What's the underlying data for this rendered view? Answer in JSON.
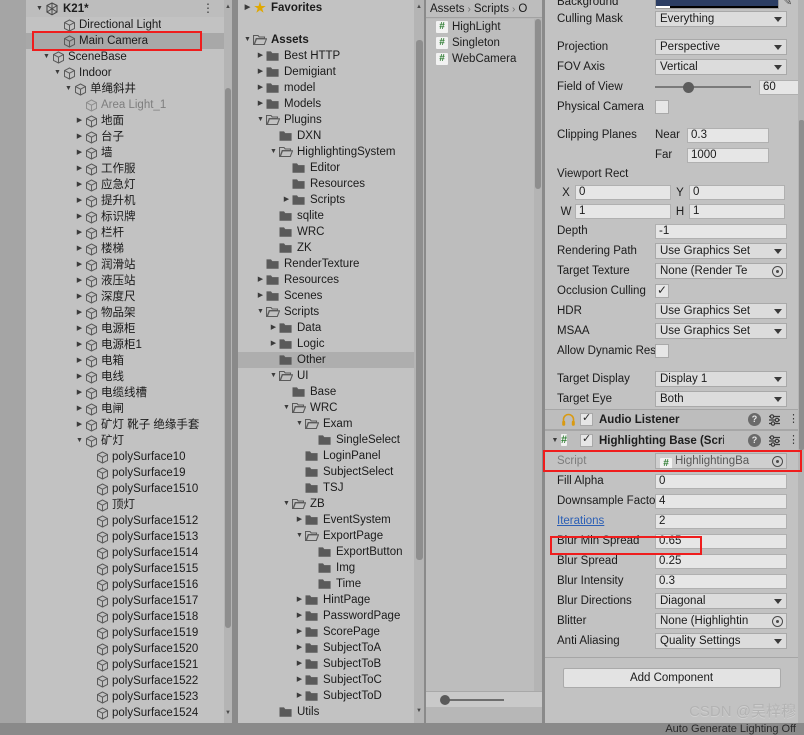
{
  "hierarchy": {
    "scene": {
      "name": "K21*",
      "kebab": "⋮"
    },
    "items": [
      {
        "label": "Directional Light",
        "depth": 2,
        "tri": "none"
      },
      {
        "label": "Main Camera",
        "depth": 2,
        "tri": "none",
        "selected": true
      },
      {
        "label": "SceneBase",
        "depth": 1,
        "tri": "down"
      },
      {
        "label": "Indoor",
        "depth": 2,
        "tri": "down"
      },
      {
        "label": "单绳斜井",
        "depth": 3,
        "tri": "down"
      },
      {
        "label": "Area Light_1",
        "depth": 4,
        "tri": "none",
        "dim": true
      },
      {
        "label": "地面",
        "depth": 4,
        "tri": "right"
      },
      {
        "label": "台子",
        "depth": 4,
        "tri": "right"
      },
      {
        "label": "墙",
        "depth": 4,
        "tri": "right"
      },
      {
        "label": "工作服",
        "depth": 4,
        "tri": "right"
      },
      {
        "label": "应急灯",
        "depth": 4,
        "tri": "right"
      },
      {
        "label": "提升机",
        "depth": 4,
        "tri": "right"
      },
      {
        "label": "标识牌",
        "depth": 4,
        "tri": "right"
      },
      {
        "label": "栏杆",
        "depth": 4,
        "tri": "right"
      },
      {
        "label": "楼梯",
        "depth": 4,
        "tri": "right"
      },
      {
        "label": "润滑站",
        "depth": 4,
        "tri": "right"
      },
      {
        "label": "液压站",
        "depth": 4,
        "tri": "right"
      },
      {
        "label": "深度尺",
        "depth": 4,
        "tri": "right"
      },
      {
        "label": "物品架",
        "depth": 4,
        "tri": "right"
      },
      {
        "label": "电源柜",
        "depth": 4,
        "tri": "right"
      },
      {
        "label": "电源柜1",
        "depth": 4,
        "tri": "right"
      },
      {
        "label": "电箱",
        "depth": 4,
        "tri": "right"
      },
      {
        "label": "电线",
        "depth": 4,
        "tri": "right"
      },
      {
        "label": "电缆线槽",
        "depth": 4,
        "tri": "right"
      },
      {
        "label": "电闸",
        "depth": 4,
        "tri": "right"
      },
      {
        "label": "矿灯 靴子 绝缘手套",
        "depth": 4,
        "tri": "right"
      },
      {
        "label": "矿灯",
        "depth": 4,
        "tri": "down"
      },
      {
        "label": "polySurface10",
        "depth": 5,
        "tri": "none"
      },
      {
        "label": "polySurface19",
        "depth": 5,
        "tri": "none"
      },
      {
        "label": "polySurface1510",
        "depth": 5,
        "tri": "none"
      },
      {
        "label": "顶灯",
        "depth": 5,
        "tri": "none"
      },
      {
        "label": "polySurface1512",
        "depth": 5,
        "tri": "none"
      },
      {
        "label": "polySurface1513",
        "depth": 5,
        "tri": "none"
      },
      {
        "label": "polySurface1514",
        "depth": 5,
        "tri": "none"
      },
      {
        "label": "polySurface1515",
        "depth": 5,
        "tri": "none"
      },
      {
        "label": "polySurface1516",
        "depth": 5,
        "tri": "none"
      },
      {
        "label": "polySurface1517",
        "depth": 5,
        "tri": "none"
      },
      {
        "label": "polySurface1518",
        "depth": 5,
        "tri": "none"
      },
      {
        "label": "polySurface1519",
        "depth": 5,
        "tri": "none"
      },
      {
        "label": "polySurface1520",
        "depth": 5,
        "tri": "none"
      },
      {
        "label": "polySurface1521",
        "depth": 5,
        "tri": "none"
      },
      {
        "label": "polySurface1522",
        "depth": 5,
        "tri": "none"
      },
      {
        "label": "polySurface1523",
        "depth": 5,
        "tri": "none"
      },
      {
        "label": "polySurface1524",
        "depth": 5,
        "tri": "none"
      }
    ]
  },
  "project": {
    "items": [
      {
        "label": "Favorites",
        "depth": 0,
        "tri": "right",
        "icon": "star",
        "bold": true
      },
      {
        "label": "",
        "depth": 0,
        "tri": "none",
        "icon": "none",
        "blank": true
      },
      {
        "label": "Assets",
        "depth": 0,
        "tri": "down",
        "icon": "folder-open",
        "bold": true
      },
      {
        "label": "Best HTTP",
        "depth": 1,
        "tri": "right",
        "icon": "folder"
      },
      {
        "label": "Demigiant",
        "depth": 1,
        "tri": "right",
        "icon": "folder"
      },
      {
        "label": "model",
        "depth": 1,
        "tri": "right",
        "icon": "folder"
      },
      {
        "label": "Models",
        "depth": 1,
        "tri": "right",
        "icon": "folder"
      },
      {
        "label": "Plugins",
        "depth": 1,
        "tri": "down",
        "icon": "folder-open"
      },
      {
        "label": "DXN",
        "depth": 2,
        "tri": "none",
        "icon": "folder"
      },
      {
        "label": "HighlightingSystem",
        "depth": 2,
        "tri": "down",
        "icon": "folder-open"
      },
      {
        "label": "Editor",
        "depth": 3,
        "tri": "none",
        "icon": "folder"
      },
      {
        "label": "Resources",
        "depth": 3,
        "tri": "none",
        "icon": "folder"
      },
      {
        "label": "Scripts",
        "depth": 3,
        "tri": "right",
        "icon": "folder"
      },
      {
        "label": "sqlite",
        "depth": 2,
        "tri": "none",
        "icon": "folder"
      },
      {
        "label": "WRC",
        "depth": 2,
        "tri": "none",
        "icon": "folder"
      },
      {
        "label": "ZK",
        "depth": 2,
        "tri": "none",
        "icon": "folder"
      },
      {
        "label": "RenderTexture",
        "depth": 1,
        "tri": "none",
        "icon": "folder"
      },
      {
        "label": "Resources",
        "depth": 1,
        "tri": "right",
        "icon": "folder"
      },
      {
        "label": "Scenes",
        "depth": 1,
        "tri": "right",
        "icon": "folder"
      },
      {
        "label": "Scripts",
        "depth": 1,
        "tri": "down",
        "icon": "folder-open"
      },
      {
        "label": "Data",
        "depth": 2,
        "tri": "right",
        "icon": "folder"
      },
      {
        "label": "Logic",
        "depth": 2,
        "tri": "right",
        "icon": "folder"
      },
      {
        "label": "Other",
        "depth": 2,
        "tri": "none",
        "icon": "folder",
        "selected": true
      },
      {
        "label": "UI",
        "depth": 2,
        "tri": "down",
        "icon": "folder-open"
      },
      {
        "label": "Base",
        "depth": 3,
        "tri": "none",
        "icon": "folder"
      },
      {
        "label": "WRC",
        "depth": 3,
        "tri": "down",
        "icon": "folder-open"
      },
      {
        "label": "Exam",
        "depth": 4,
        "tri": "down",
        "icon": "folder-open"
      },
      {
        "label": "SingleSelect",
        "depth": 5,
        "tri": "none",
        "icon": "folder"
      },
      {
        "label": "LoginPanel",
        "depth": 4,
        "tri": "none",
        "icon": "folder"
      },
      {
        "label": "SubjectSelect",
        "depth": 4,
        "tri": "none",
        "icon": "folder"
      },
      {
        "label": "TSJ",
        "depth": 4,
        "tri": "none",
        "icon": "folder"
      },
      {
        "label": "ZB",
        "depth": 3,
        "tri": "down",
        "icon": "folder-open"
      },
      {
        "label": "EventSystem",
        "depth": 4,
        "tri": "right",
        "icon": "folder"
      },
      {
        "label": "ExportPage",
        "depth": 4,
        "tri": "down",
        "icon": "folder-open"
      },
      {
        "label": "ExportButton",
        "depth": 5,
        "tri": "none",
        "icon": "folder"
      },
      {
        "label": "Img",
        "depth": 5,
        "tri": "none",
        "icon": "folder"
      },
      {
        "label": "Time",
        "depth": 5,
        "tri": "none",
        "icon": "folder"
      },
      {
        "label": "HintPage",
        "depth": 4,
        "tri": "right",
        "icon": "folder"
      },
      {
        "label": "PasswordPage",
        "depth": 4,
        "tri": "right",
        "icon": "folder"
      },
      {
        "label": "ScorePage",
        "depth": 4,
        "tri": "right",
        "icon": "folder"
      },
      {
        "label": "SubjectToA",
        "depth": 4,
        "tri": "right",
        "icon": "folder"
      },
      {
        "label": "SubjectToB",
        "depth": 4,
        "tri": "right",
        "icon": "folder"
      },
      {
        "label": "SubjectToC",
        "depth": 4,
        "tri": "right",
        "icon": "folder"
      },
      {
        "label": "SubjectToD",
        "depth": 4,
        "tri": "right",
        "icon": "folder"
      },
      {
        "label": "Utils",
        "depth": 2,
        "tri": "none",
        "icon": "folder"
      }
    ]
  },
  "assets": {
    "breadcrumb": [
      "Assets",
      "Scripts",
      "O"
    ],
    "files": [
      {
        "name": "HighLight",
        "icon": "csharp-script-icon"
      },
      {
        "name": "Singleton",
        "icon": "csharp-script-icon"
      },
      {
        "name": "WebCamera",
        "icon": "csharp-script-icon"
      }
    ]
  },
  "inspector": {
    "camera": {
      "background_label": "Background",
      "background_color": "#2b3d63",
      "rows": [
        {
          "label": "Culling Mask",
          "type": "dropdown",
          "value": "Everything"
        },
        {
          "label": "",
          "type": "spacer"
        },
        {
          "label": "Projection",
          "type": "dropdown",
          "value": "Perspective"
        },
        {
          "label": "FOV Axis",
          "type": "dropdown",
          "value": "Vertical"
        },
        {
          "label": "Field of View",
          "type": "slider",
          "value": "60"
        },
        {
          "label": "Physical Camera",
          "type": "checkbox",
          "checked": false
        },
        {
          "label": "",
          "type": "spacer"
        }
      ],
      "clipping_planes_label": "Clipping Planes",
      "near_label": "Near",
      "near_value": "0.3",
      "far_label": "Far",
      "far_value": "1000",
      "viewport_rect_label": "Viewport Rect",
      "viewport": {
        "x_label": "X",
        "x": "0",
        "y_label": "Y",
        "y": "0",
        "w_label": "W",
        "w": "1",
        "h_label": "H",
        "h": "1"
      },
      "rows2": [
        {
          "label": "Depth",
          "type": "field",
          "value": "-1"
        },
        {
          "label": "Rendering Path",
          "type": "dropdown",
          "value": "Use Graphics Set"
        },
        {
          "label": "Target Texture",
          "type": "object",
          "value": "None (Render Te"
        },
        {
          "label": "Occlusion Culling",
          "type": "checkbox",
          "checked": true
        },
        {
          "label": "HDR",
          "type": "dropdown",
          "value": "Use Graphics Set"
        },
        {
          "label": "MSAA",
          "type": "dropdown",
          "value": "Use Graphics Set"
        },
        {
          "label": "Allow Dynamic Resol",
          "type": "checkbox",
          "checked": false
        },
        {
          "label": "",
          "type": "spacer"
        },
        {
          "label": "Target Display",
          "type": "dropdown",
          "value": "Display 1"
        },
        {
          "label": "Target Eye",
          "type": "dropdown",
          "value": "Both"
        }
      ]
    },
    "components": [
      {
        "title": "Audio Listener",
        "icon": "headphones-icon",
        "enabled": true,
        "folded": false,
        "has_foldout": false
      },
      {
        "title": "Highlighting Base (Script)",
        "icon": "csharp-script-icon",
        "enabled": true,
        "folded": false,
        "has_foldout": true,
        "highlighted": true
      }
    ],
    "highlighting_base": {
      "rows": [
        {
          "label": "Script",
          "type": "object-dim",
          "value": "HighlightingBa"
        },
        {
          "label": "Fill Alpha",
          "type": "field",
          "value": "0"
        },
        {
          "label": "Downsample Factor",
          "type": "field",
          "value": "4"
        },
        {
          "label": "Iterations",
          "type": "field",
          "value": "2",
          "link": true,
          "highlighted": true
        },
        {
          "label": "Blur Min Spread",
          "type": "field",
          "value": "0.65"
        },
        {
          "label": "Blur Spread",
          "type": "field",
          "value": "0.25"
        },
        {
          "label": "Blur Intensity",
          "type": "field",
          "value": "0.3"
        },
        {
          "label": "Blur Directions",
          "type": "dropdown",
          "value": "Diagonal"
        },
        {
          "label": "Blitter",
          "type": "object",
          "value": "None (Highlightin"
        },
        {
          "label": "Anti Aliasing",
          "type": "dropdown",
          "value": "Quality Settings"
        }
      ]
    },
    "add_component_label": "Add Component"
  },
  "watermark": "CSDN @吴梓穆",
  "statusbar": {
    "text": "Auto Generate Lighting Off"
  },
  "annotation_color": "#ef1d1d"
}
